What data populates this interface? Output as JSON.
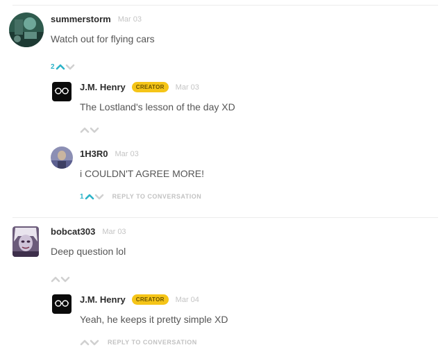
{
  "thread": [
    {
      "username": "summerstorm",
      "date": "Mar 03",
      "text": "Watch out for flying cars",
      "vote_count": "2",
      "replies": [
        {
          "username": "J.M. Henry",
          "badge": "CREATOR",
          "date": "Mar 03",
          "text": "The Lostland's lesson of the day XD"
        },
        {
          "username": "1H3R0",
          "date": "Mar 03",
          "text": "i COULDN'T AGREE MORE!",
          "vote_count": "1",
          "reply_label": "REPLY TO CONVERSATION"
        }
      ]
    },
    {
      "username": "bobcat303",
      "date": "Mar 03",
      "text": "Deep question lol",
      "replies": [
        {
          "username": "J.M. Henry",
          "badge": "CREATOR",
          "date": "Mar 04",
          "text": "Yeah, he keeps it pretty simple XD",
          "reply_label": "REPLY TO CONVERSATION"
        }
      ]
    }
  ],
  "colors": {
    "accent_teal": "#2bb3c8",
    "creator_badge": "#f5c518",
    "muted": "#c4c4c4"
  },
  "icons": [
    "upvote-icon",
    "downvote-icon",
    "glasses-logo-icon"
  ]
}
